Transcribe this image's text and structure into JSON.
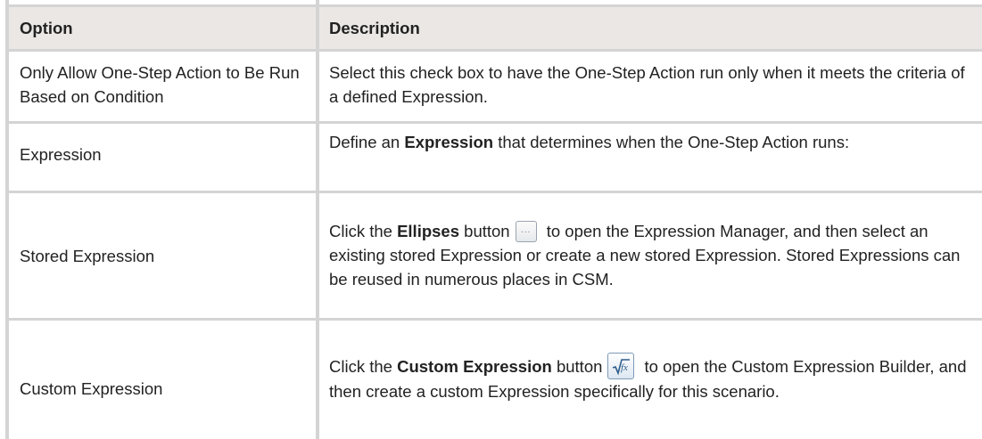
{
  "table": {
    "headers": [
      "Option",
      "Description"
    ],
    "rows": [
      {
        "option": "Only Allow One-Step Action to Be Run Based on Condition",
        "description": "Select this check box to have the One-Step Action run only when it meets the criteria of a defined Expression."
      },
      {
        "option": "Expression",
        "desc_pre": "Define an ",
        "desc_bold": "Expression",
        "desc_post": " that determines when the One-Step Action runs:"
      },
      {
        "option": "Stored Expression",
        "desc_pre": "Click the ",
        "desc_bold": "Ellipses",
        "desc_mid": " button",
        "desc_post": " to open the Expression Manager, and then select an existing stored Expression or create a new stored Expression. Stored Expressions can be reused in numerous places in CSM.",
        "icon": "ellipses-button-icon",
        "icon_text": "..."
      },
      {
        "option": "Custom Expression",
        "desc_pre": "Click the ",
        "desc_bold": "Custom Expression",
        "desc_mid": " button",
        "desc_post": " to open the Custom Expression Builder, and then create a custom Expression specifically for this scenario.",
        "icon": "custom-expression-fx-icon"
      }
    ]
  }
}
